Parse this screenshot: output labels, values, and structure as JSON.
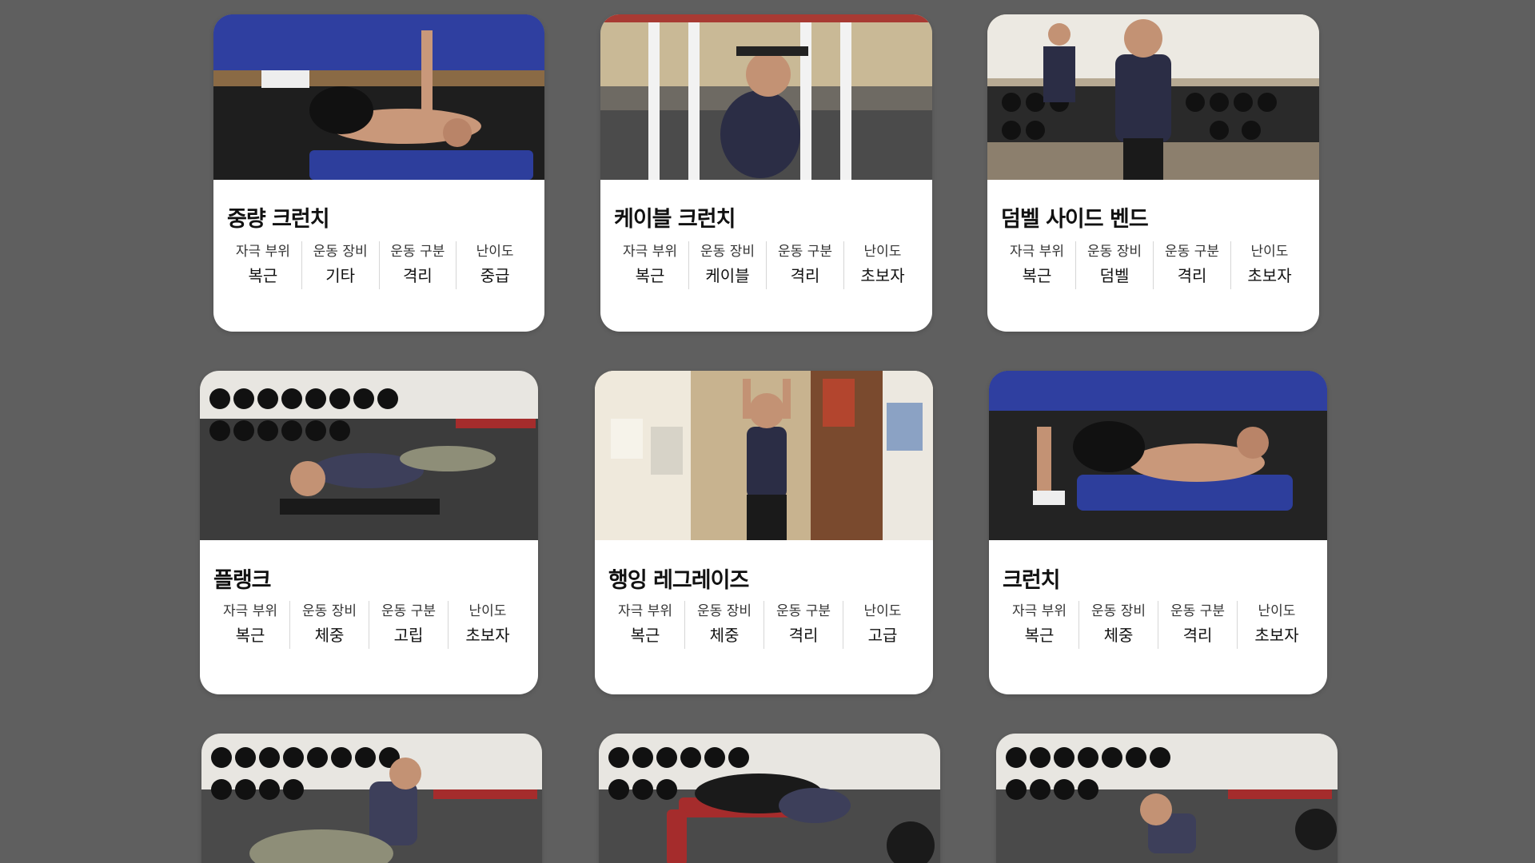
{
  "stat_labels": {
    "target": "자극 부위",
    "equipment": "운동 장비",
    "type": "운동 구분",
    "difficulty": "난이도"
  },
  "exercises": [
    {
      "name": "중량 크런치",
      "target": "복근",
      "equipment": "기타",
      "type": "격리",
      "difficulty": "중급"
    },
    {
      "name": "케이블 크런치",
      "target": "복근",
      "equipment": "케이블",
      "type": "격리",
      "difficulty": "초보자"
    },
    {
      "name": "덤벨 사이드 벤드",
      "target": "복근",
      "equipment": "덤벨",
      "type": "격리",
      "difficulty": "초보자"
    },
    {
      "name": "플랭크",
      "target": "복근",
      "equipment": "체중",
      "type": "고립",
      "difficulty": "초보자"
    },
    {
      "name": "행잉 레그레이즈",
      "target": "복근",
      "equipment": "체중",
      "type": "격리",
      "difficulty": "고급"
    },
    {
      "name": "크런치",
      "target": "복근",
      "equipment": "체중",
      "type": "격리",
      "difficulty": "초보자"
    }
  ],
  "colors": {
    "background": "#5f5f5f",
    "card": "#ffffff",
    "gym_floor": "#2a2a2a",
    "gym_wall_blue": "#2f3fa0",
    "mat_blue": "#2d3e9c"
  }
}
